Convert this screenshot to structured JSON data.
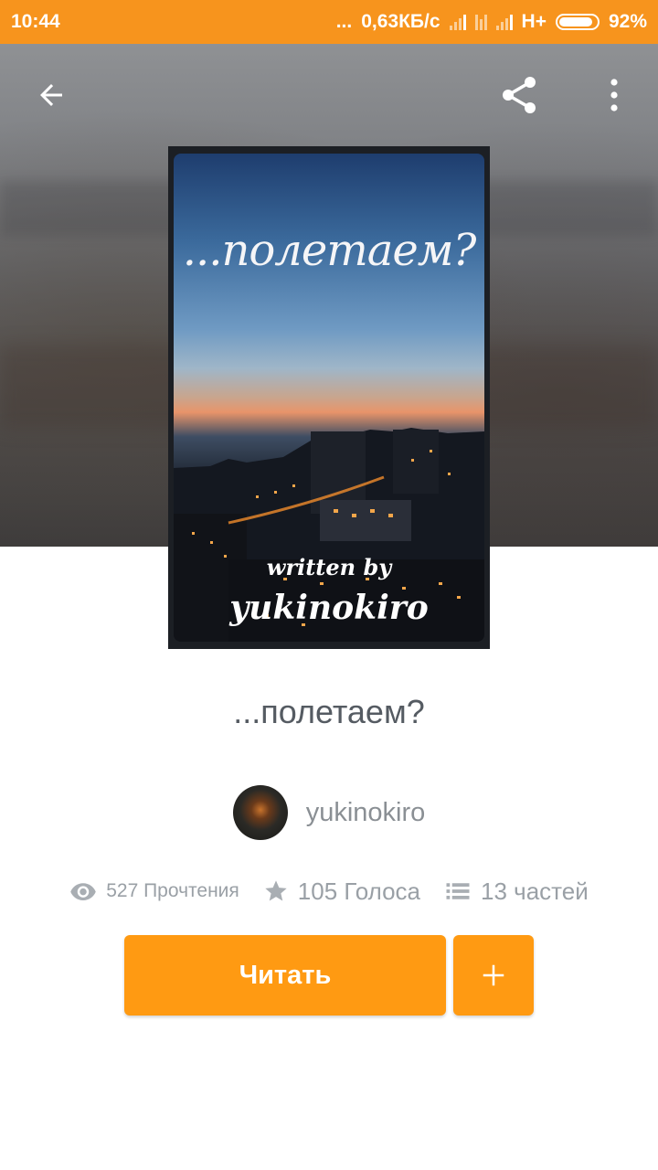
{
  "status_bar": {
    "time": "10:44",
    "dots": "...",
    "network_speed": "0,63КБ/с",
    "network_type": "H+",
    "battery_percent": "92%",
    "battery_level": 0.92
  },
  "toolbar": {
    "back_icon": "arrow-left-icon",
    "share_icon": "share-icon",
    "more_icon": "more-vertical-icon"
  },
  "cover": {
    "title_text": "...полетаем?",
    "written_by": "written by",
    "author_text": "yukinokiro"
  },
  "book": {
    "title": "...полетаем?",
    "author": "yukinokiro"
  },
  "stats": {
    "reads": "527 Прочтения",
    "votes": "105 Голоса",
    "parts": "13 частей"
  },
  "actions": {
    "read_label": "Читать",
    "add_icon": "plus-icon"
  },
  "colors": {
    "accent": "#f7941d",
    "button": "#ff9a12",
    "text_muted": "#9aa0a6"
  }
}
